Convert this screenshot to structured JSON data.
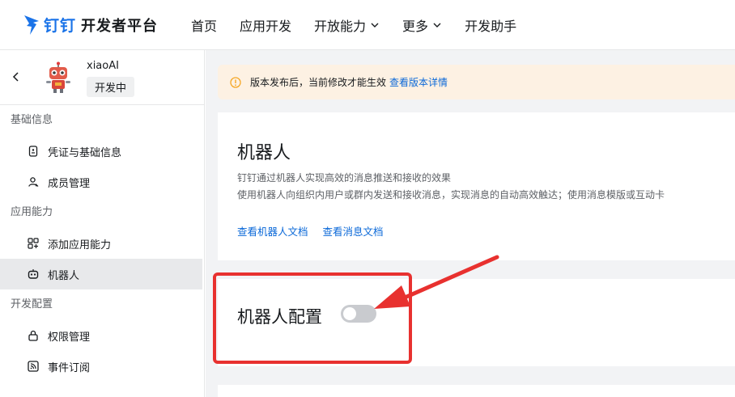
{
  "header": {
    "logo_brand": "钉钉",
    "logo_subtitle": "开发者平台",
    "nav": [
      {
        "label": "首页"
      },
      {
        "label": "应用开发"
      },
      {
        "label": "开放能力"
      },
      {
        "label": "更多"
      },
      {
        "label": "开发助手"
      }
    ]
  },
  "sidebar": {
    "app_name": "xiaoAI",
    "app_status": "开发中",
    "groups": [
      {
        "title": "基础信息",
        "items": [
          {
            "label": "凭证与基础信息",
            "icon": "id-card-icon"
          },
          {
            "label": "成员管理",
            "icon": "user-icon"
          }
        ]
      },
      {
        "title": "应用能力",
        "items": [
          {
            "label": "添加应用能力",
            "icon": "grid-add-icon"
          },
          {
            "label": "机器人",
            "icon": "robot-icon",
            "active": true
          }
        ]
      },
      {
        "title": "开发配置",
        "items": [
          {
            "label": "权限管理",
            "icon": "lock-icon"
          },
          {
            "label": "事件订阅",
            "icon": "rss-icon"
          }
        ]
      }
    ]
  },
  "notice": {
    "text": "版本发布后，当前修改才能生效",
    "link": "查看版本详情"
  },
  "robot_card": {
    "title": "机器人",
    "desc_line1": "钉钉通过机器人实现高效的消息推送和接收的效果",
    "desc_line2": "使用机器人向组织内用户或群内发送和接收消息，实现消息的自动高效触达；使用消息模版或互动卡",
    "link_docs": "查看机器人文档",
    "link_msg_docs": "查看消息文档"
  },
  "config_card": {
    "title": "机器人配置",
    "toggle_on": false
  },
  "colors": {
    "brand_blue": "#1a73e8",
    "link_blue": "#0a68d8",
    "annotation_red": "#e8312f",
    "notice_bg": "#fdf1e3",
    "notice_icon": "#f5a623"
  }
}
